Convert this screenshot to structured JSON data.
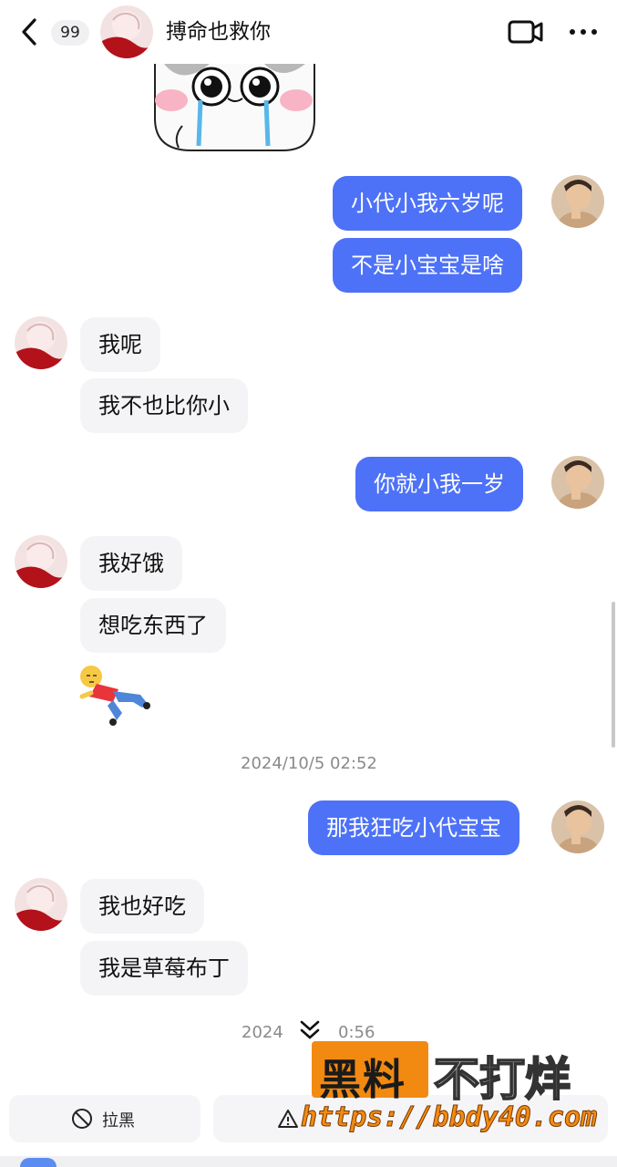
{
  "header": {
    "unread_count": "99",
    "contact_name": "搏命也救你"
  },
  "messages": [
    {
      "side": "me",
      "text": "小代小我六岁呢"
    },
    {
      "side": "me",
      "text": "不是小宝宝是啥"
    },
    {
      "side": "them",
      "text": "我呢"
    },
    {
      "side": "them",
      "text": "我不也比你小"
    },
    {
      "side": "me",
      "text": "你就小我一岁"
    },
    {
      "side": "them",
      "text": "我好饿"
    },
    {
      "side": "them",
      "text": "想吃东西了"
    },
    {
      "side": "me",
      "text": "那我狂吃小代宝宝"
    },
    {
      "side": "them",
      "text": "我也好吃"
    },
    {
      "side": "them",
      "text": "我是草莓布丁"
    }
  ],
  "timestamps": [
    "2024/10/5 02:52",
    "2024",
    "0:56"
  ],
  "bottom_actions": {
    "block_label": "拉黑"
  },
  "watermark": {
    "brand_a": "黑料",
    "brand_b": "不打烊",
    "url": "https://bbdy40.com"
  },
  "colors": {
    "my_bubble": "#4d72f7",
    "their_bubble": "#f4f4f6",
    "watermark_orange": "#f28a12"
  }
}
